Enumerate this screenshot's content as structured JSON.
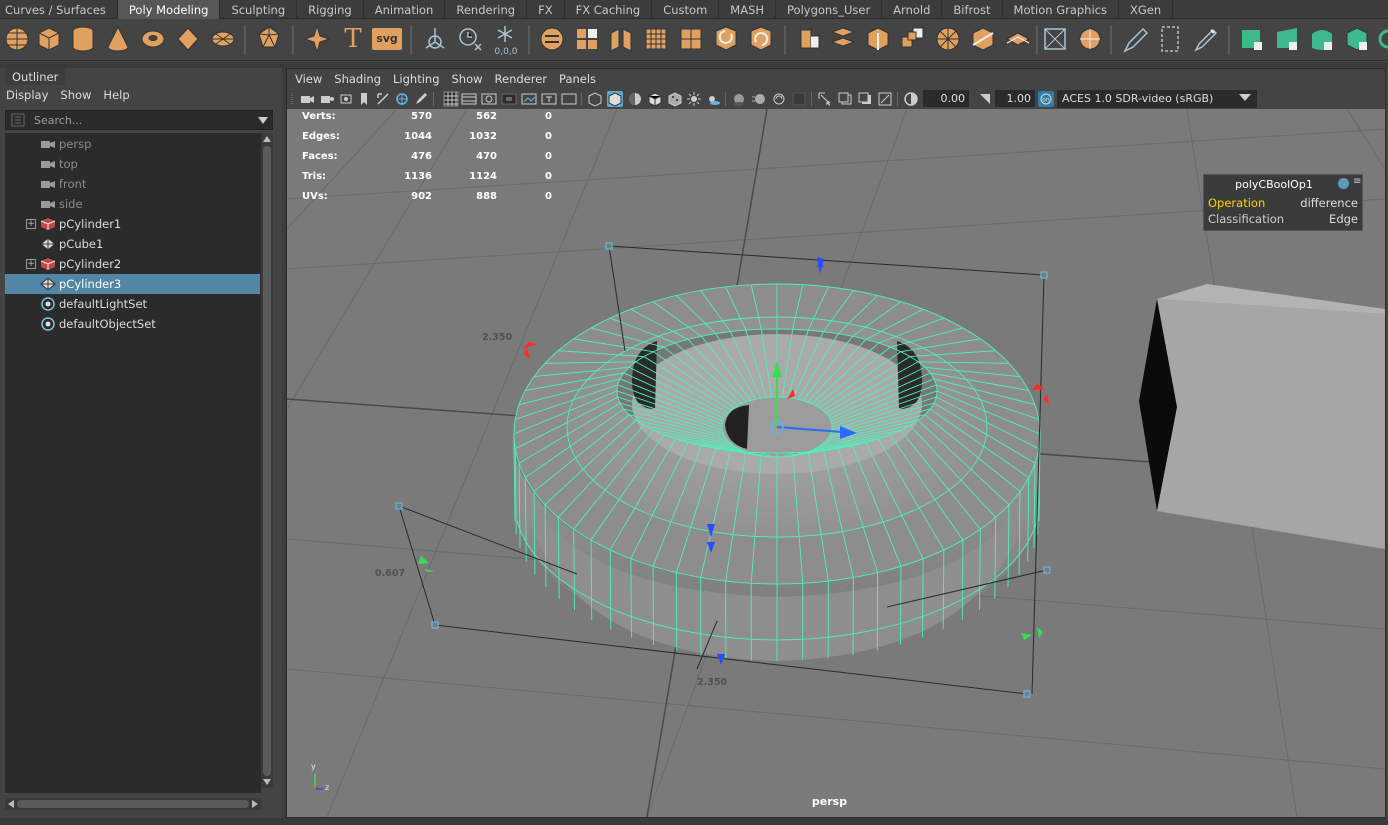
{
  "shelf": {
    "tabs": [
      "Curves / Surfaces",
      "Poly Modeling",
      "Sculpting",
      "Rigging",
      "Animation",
      "Rendering",
      "FX",
      "FX Caching",
      "Custom",
      "MASH",
      "Polygons_User",
      "Arnold",
      "Bifrost",
      "Motion Graphics",
      "XGen"
    ],
    "active_tab": "Poly Modeling",
    "icon_text": {
      "svg": "svg",
      "text": "T",
      "origin": "0,0,0"
    }
  },
  "outliner": {
    "tab_label": "Outliner",
    "menu": [
      "Display",
      "Show",
      "Help"
    ],
    "search_placeholder": "Search...",
    "items": [
      {
        "label": "persp",
        "icon": "camera-icon",
        "dim": true,
        "expander": false
      },
      {
        "label": "top",
        "icon": "camera-icon",
        "dim": true,
        "expander": false
      },
      {
        "label": "front",
        "icon": "camera-icon",
        "dim": true,
        "expander": false
      },
      {
        "label": "side",
        "icon": "camera-icon",
        "dim": true,
        "expander": false
      },
      {
        "label": "pCylinder1",
        "icon": "group-mesh-icon",
        "dim": false,
        "expander": true
      },
      {
        "label": "pCube1",
        "icon": "mesh-icon",
        "dim": false,
        "expander": false
      },
      {
        "label": "pCylinder2",
        "icon": "group-mesh-icon",
        "dim": false,
        "expander": true
      },
      {
        "label": "pCylinder3",
        "icon": "mesh-icon",
        "dim": false,
        "expander": false,
        "selected": true
      },
      {
        "label": "defaultLightSet",
        "icon": "set-icon",
        "dim": false,
        "expander": false
      },
      {
        "label": "defaultObjectSet",
        "icon": "set-icon",
        "dim": false,
        "expander": false
      }
    ]
  },
  "viewport": {
    "menu": [
      "View",
      "Shading",
      "Lighting",
      "Show",
      "Renderer",
      "Panels"
    ],
    "exposure": "0.00",
    "gamma": "1.00",
    "color_space": "ACES 1.0 SDR-video (sRGB)",
    "camera": "persp",
    "hud": [
      {
        "label": "Verts:",
        "a": "570",
        "b": "562",
        "c": "0"
      },
      {
        "label": "Edges:",
        "a": "1044",
        "b": "1032",
        "c": "0"
      },
      {
        "label": "Faces:",
        "a": "476",
        "b": "470",
        "c": "0"
      },
      {
        "label": "Tris:",
        "a": "1136",
        "b": "1124",
        "c": "0"
      },
      {
        "label": "UVs:",
        "a": "902",
        "b": "888",
        "c": "0"
      }
    ],
    "dim_labels": [
      "2.350",
      "0.607",
      "2.350"
    ],
    "axis": {
      "y": "y",
      "z": "z"
    }
  },
  "attr_box": {
    "title": "polyCBoolOp1",
    "rows": [
      {
        "key": "Operation",
        "value": "difference",
        "key_color": "#ffd400"
      },
      {
        "key": "Classification",
        "value": "Edge",
        "key_color": "#cccccc"
      }
    ]
  },
  "colors": {
    "accent_selected": "#5285a6",
    "shelf_icon": "#e0a060",
    "wireframe": "#4cf2b8",
    "viewport_bg": "#7a7a7a"
  }
}
